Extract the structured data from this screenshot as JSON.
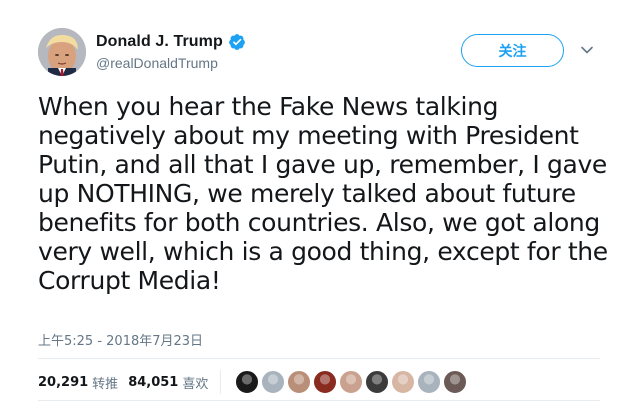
{
  "tweet": {
    "display_name": "Donald J. Trump",
    "handle": "@realDonaldTrump",
    "follow_label": "关注",
    "text": "When you hear the Fake News talking negatively about my meeting with President Putin, and all that I gave up, remember, I gave up NOTHING, we merely talked about future benefits for both countries. Also, we got along very well, which is a good thing, except for the Corrupt Media!",
    "timestamp": "上午5:25 - 2018年7月23日"
  },
  "stats": {
    "retweets_count": "20,291",
    "retweets_label": "转推",
    "likes_count": "84,051",
    "likes_label": "喜欢"
  },
  "icons": {
    "verified": "verified-badge-icon",
    "menu": "chevron-down-icon"
  },
  "colors": {
    "accent": "#1da1f2",
    "text": "#14171a",
    "secondary": "#657786",
    "divider": "#e6ecf0"
  },
  "liker_avatars": [
    {
      "color": "#1a1a1a"
    },
    {
      "color": "#a8b3bd"
    },
    {
      "color": "#b98f7a"
    },
    {
      "color": "#8a2b1f"
    },
    {
      "color": "#c9a18e"
    },
    {
      "color": "#3b3b3b"
    },
    {
      "color": "#d8b6a4"
    },
    {
      "color": "#a8b3bd"
    },
    {
      "color": "#6b5a55"
    }
  ]
}
